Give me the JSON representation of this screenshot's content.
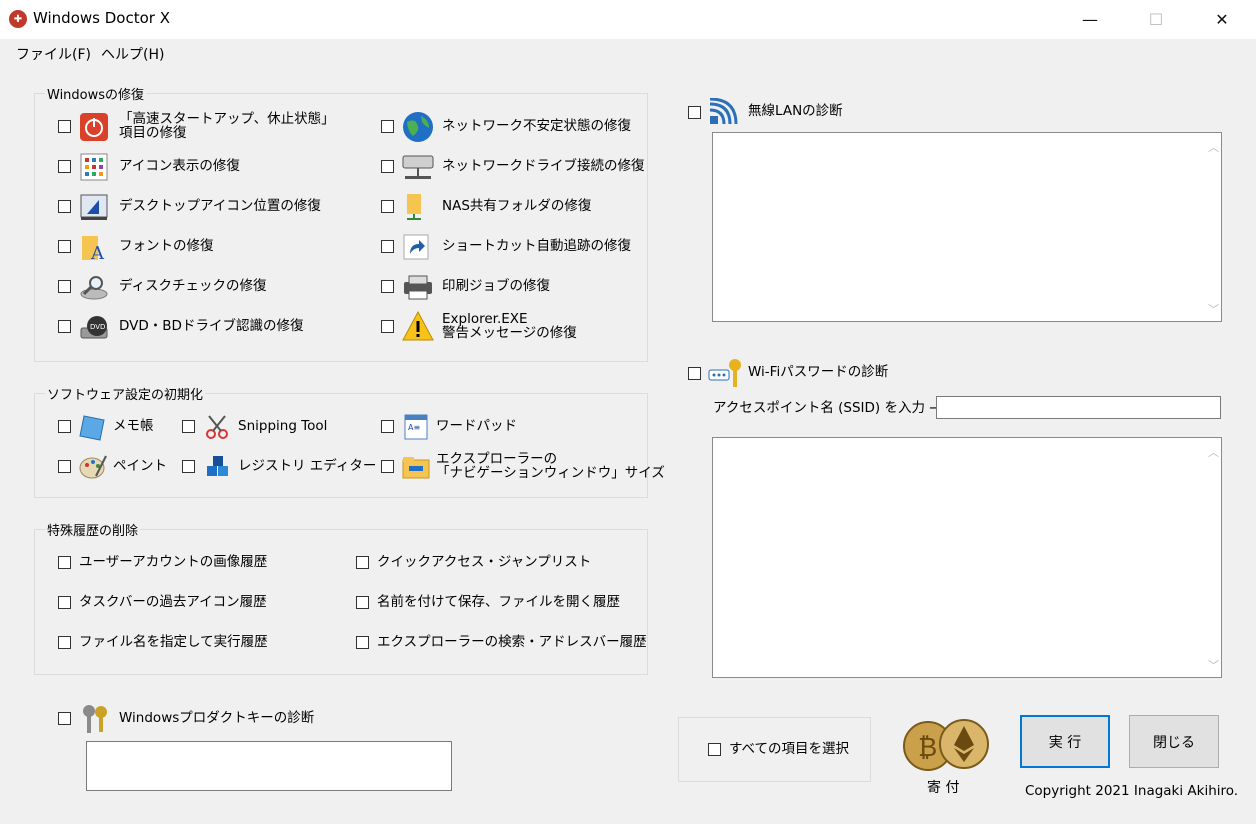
{
  "window": {
    "title": "Windows Doctor X",
    "minimize": "—",
    "maximize": "☐",
    "close": "✕"
  },
  "menu": {
    "file": "ファイル(F)",
    "help": "ヘルプ(H)"
  },
  "groups": {
    "repair": {
      "title": "Windowsの修復",
      "items": [
        {
          "label_l1": "「高速スタートアップ、休止状態」",
          "label_l2": "項目の修復"
        },
        {
          "label": "アイコン表示の修復"
        },
        {
          "label": "デスクトップアイコン位置の修復"
        },
        {
          "label": "フォントの修復"
        },
        {
          "label": "ディスクチェックの修復"
        },
        {
          "label": "DVD・BDドライブ認識の修復"
        },
        {
          "label": "ネットワーク不安定状態の修復"
        },
        {
          "label": "ネットワークドライブ接続の修復"
        },
        {
          "label": "NAS共有フォルダの修復"
        },
        {
          "label": "ショートカット自動追跡の修復"
        },
        {
          "label": "印刷ジョブの修復"
        },
        {
          "label_l1": "Explorer.EXE",
          "label_l2": "警告メッセージの修復"
        }
      ]
    },
    "software": {
      "title": "ソフトウェア設定の初期化",
      "items": [
        {
          "label": "メモ帳"
        },
        {
          "label": "ペイント"
        },
        {
          "label": "Snipping Tool"
        },
        {
          "label": "レジストリ エディター"
        },
        {
          "label": "ワードパッド"
        },
        {
          "label_l1": "エクスプローラーの",
          "label_l2": "「ナビゲーションウィンドウ」サイズ"
        }
      ]
    },
    "history": {
      "title": "特殊履歴の削除",
      "items": [
        {
          "label": "ユーザーアカウントの画像履歴"
        },
        {
          "label": "タスクバーの過去アイコン履歴"
        },
        {
          "label": "ファイル名を指定して実行履歴"
        },
        {
          "label": "クイックアクセス・ジャンプリスト"
        },
        {
          "label": "名前を付けて保存、ファイルを開く履歴"
        },
        {
          "label": "エクスプローラーの検索・アドレスバー履歴"
        }
      ]
    }
  },
  "product_key": {
    "label": "Windowsプロダクトキーの診断",
    "value": ""
  },
  "wlan": {
    "label": "無線LANの診断",
    "output": ""
  },
  "wifi": {
    "label": "Wi-Fiパスワードの診断",
    "ssid_label": "アクセスポイント名 (SSID) を入力 →",
    "ssid_value": "",
    "output": ""
  },
  "footer": {
    "select_all": "すべての項目を選択",
    "donate": "寄 付",
    "run": "実 行",
    "close": "閉じる",
    "copyright": "Copyright 2021 Inagaki Akihiro."
  },
  "colors": {
    "accent": "#0078d7",
    "panel_border": "#8a8a8a"
  }
}
